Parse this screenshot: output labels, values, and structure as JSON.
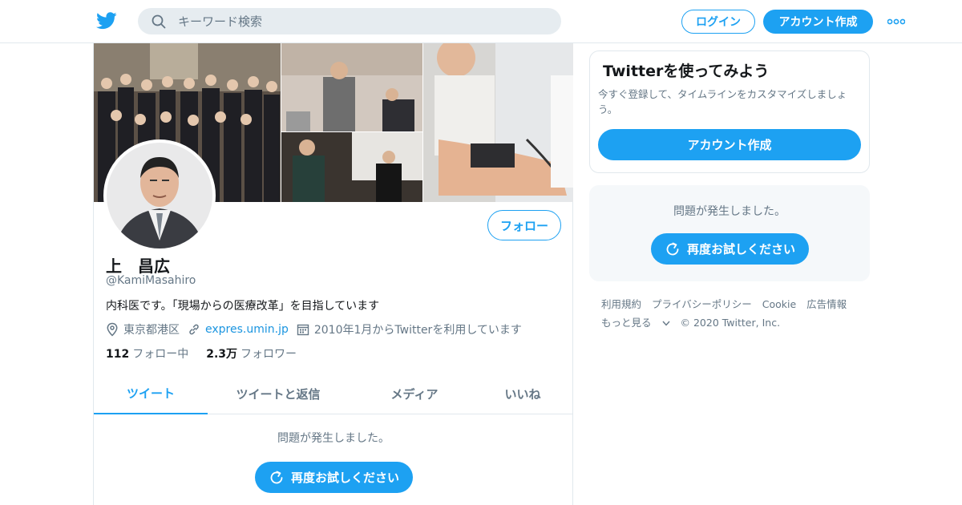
{
  "colors": {
    "accent": "#1da1f2",
    "link": "#1b95e0",
    "muted": "#657786",
    "border": "#e1e8ed",
    "panel": "#f5f8fa"
  },
  "header": {
    "search_placeholder": "キーワード検索",
    "login_label": "ログイン",
    "signup_label": "アカウント作成",
    "icons": [
      "twitter-bird-icon",
      "search-icon",
      "more-icon"
    ]
  },
  "profile": {
    "name": "上　昌広",
    "handle": "@KamiMasahiro",
    "bio": "内科医です。「現場からの医療改革」を目指しています",
    "location": "東京都港区",
    "url": "expres.umin.jp",
    "joined": "2010年1月からTwitterを利用しています",
    "follow_label": "フォロー",
    "following_count": "112",
    "following_label": "フォロー中",
    "followers_count": "2.3万",
    "followers_label": "フォロワー"
  },
  "tabs": [
    {
      "label": "ツイート"
    },
    {
      "label": "ツイートと返信"
    },
    {
      "label": "メディア"
    },
    {
      "label": "いいね"
    }
  ],
  "timeline": {
    "error_text": "問題が発生しました。",
    "retry_label": "再度お試しください"
  },
  "sidebar": {
    "signup_card": {
      "title": "Twitterを使ってみよう",
      "description": "今すぐ登録して、タイムラインをカスタマイズしましょう。",
      "cta_label": "アカウント作成"
    },
    "error_card": {
      "text": "問題が発生しました。",
      "retry_label": "再度お試しください"
    },
    "footer": {
      "links": [
        "利用規約",
        "プライバシーポリシー",
        "Cookie",
        "広告情報"
      ],
      "more_label": "もっと見る",
      "copyright": "© 2020 Twitter, Inc."
    }
  }
}
